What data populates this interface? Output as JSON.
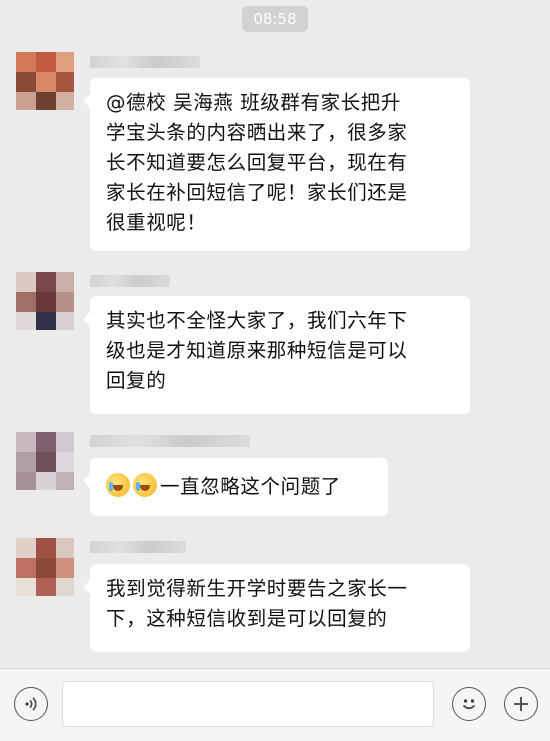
{
  "status": {
    "time": "08:58"
  },
  "messages": [
    {
      "lines": [
        "@德校 吴海燕 班级群有家长把升",
        "学宝头条的内容晒出来了，很多家",
        "长不知道要怎么回复平台，现在有",
        "家长在补回短信了呢！家长们还是",
        "很重视呢！"
      ]
    },
    {
      "lines": [
        "其实也不全怪大家了，我们六年下",
        "级也是才知道原来那种短信是可以",
        "回复的"
      ]
    },
    {
      "emojis": [
        "crying-laughing-emoji",
        "crying-laughing-emoji"
      ],
      "text": "一直忽略这个问题了"
    },
    {
      "lines": [
        "我到觉得新生开学时要告之家长一",
        "下，这种短信收到是可以回复的"
      ]
    }
  ],
  "input_bar": {
    "voice_icon": "voice-icon",
    "emoji_icon": "smiley-icon",
    "add_icon": "plus-icon",
    "input_value": ""
  },
  "colors": {
    "chat_background": "#ebebeb",
    "bubble": "#ffffff",
    "time_badge": "#d2d2d2"
  }
}
